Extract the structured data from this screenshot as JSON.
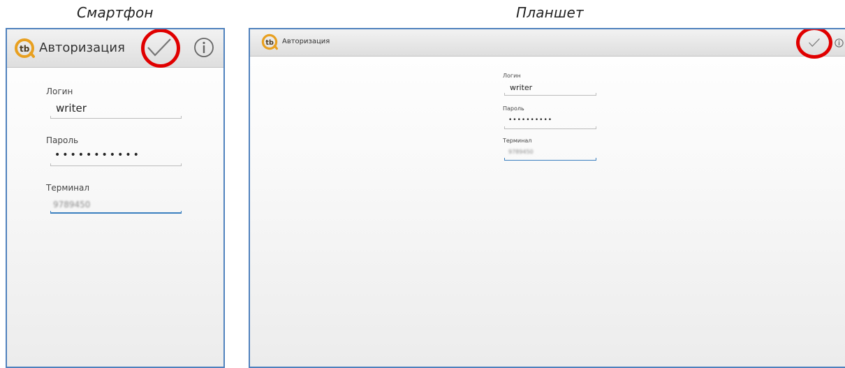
{
  "captions": {
    "smartphone": "Смартфон",
    "tablet": "Планшет"
  },
  "app": {
    "title": "Авторизация",
    "logo_text": "tb",
    "logo_color": "#e8a020"
  },
  "form": {
    "login_label": "Логин",
    "login_value": "writer",
    "password_label": "Пароль",
    "password_value": "•••••••••••",
    "password_value_tablet": "••••••••••",
    "terminal_label": "Терминал",
    "terminal_value": "9789450"
  },
  "colors": {
    "accent_ring": "#e00000",
    "device_border": "#4f81bd",
    "focus_underline": "#3a7fbf"
  },
  "icons": {
    "confirm": "checkmark-icon",
    "info": "info-icon",
    "logo": "app-logo-icon"
  }
}
